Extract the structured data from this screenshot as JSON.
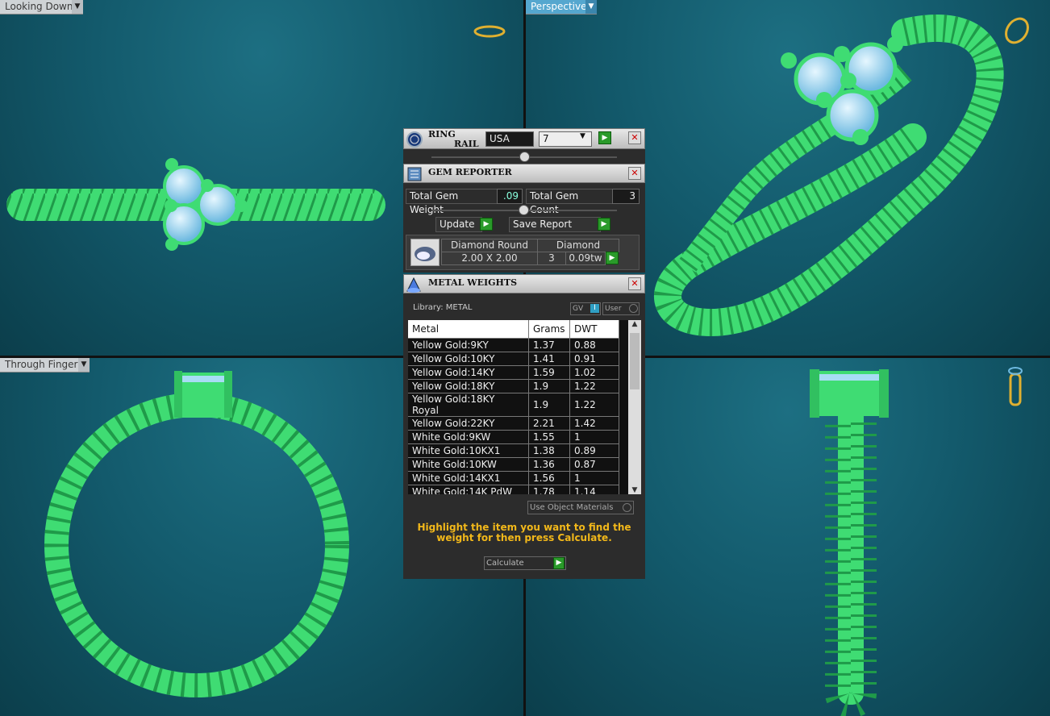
{
  "viewports": {
    "top_left": {
      "label": "Looking Down"
    },
    "top_right": {
      "label": "Perspective"
    },
    "bottom_left": {
      "label": "Through Finger"
    },
    "bottom_right": {
      "label": ""
    }
  },
  "ring_rail": {
    "title_line1": "RING",
    "title_line2": "RAIL",
    "size_system": "USA",
    "size_value": "7"
  },
  "gem_reporter": {
    "title": "GEM REPORTER",
    "total_weight_label": "Total Gem Weight",
    "total_weight_value": ".09",
    "total_count_label": "Total Gem Count",
    "total_count_value": "3",
    "update_label": "Update",
    "save_report_label": "Save Report",
    "gem": {
      "shape": "Diamond Round",
      "material": "Diamond",
      "size": "2.00 X 2.00",
      "count": "3",
      "weight": "0.09tw"
    }
  },
  "metal_weights": {
    "title": "METAL WEIGHTS",
    "library_label": "Library: METAL",
    "gv_label": "GV",
    "user_label": "User",
    "columns": [
      "Metal",
      "Grams",
      "DWT"
    ],
    "rows": [
      {
        "metal": "Yellow Gold:9KY",
        "grams": "1.37",
        "dwt": "0.88"
      },
      {
        "metal": "Yellow Gold:10KY",
        "grams": "1.41",
        "dwt": "0.91"
      },
      {
        "metal": "Yellow Gold:14KY",
        "grams": "1.59",
        "dwt": "1.02"
      },
      {
        "metal": "Yellow Gold:18KY",
        "grams": "1.9",
        "dwt": "1.22"
      },
      {
        "metal": "Yellow Gold:18KY Royal",
        "grams": "1.9",
        "dwt": "1.22"
      },
      {
        "metal": "Yellow Gold:22KY",
        "grams": "2.21",
        "dwt": "1.42"
      },
      {
        "metal": "White Gold:9KW",
        "grams": "1.55",
        "dwt": "1"
      },
      {
        "metal": "White Gold:10KX1",
        "grams": "1.38",
        "dwt": "0.89"
      },
      {
        "metal": "White Gold:10KW",
        "grams": "1.36",
        "dwt": "0.87"
      },
      {
        "metal": "White Gold:14KX1",
        "grams": "1.56",
        "dwt": "1"
      },
      {
        "metal": "White Gold:14K PdW",
        "grams": "1.78",
        "dwt": "1.14"
      }
    ],
    "use_object_materials_label": "Use Object Materials",
    "hint": "Highlight the item you want to find the weight for then press Calculate.",
    "calculate_label": "Calculate"
  },
  "colors": {
    "ring_green": "#3fdc73",
    "gem_blue": "#a8dcf5",
    "hint_yellow": "#f2b81a",
    "go_green": "#2a9a2a"
  }
}
